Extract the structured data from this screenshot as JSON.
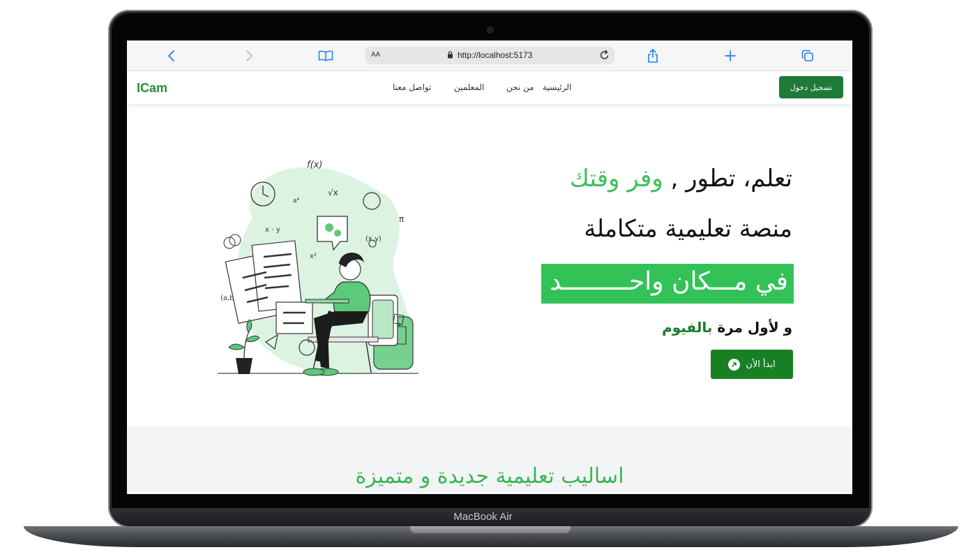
{
  "device": {
    "label": "MacBook Air"
  },
  "browser": {
    "url": "http://localhost:5173",
    "text_size_label": "AA",
    "icons": [
      "back-icon",
      "forward-icon",
      "book-icon",
      "lock-icon",
      "reload-icon",
      "share-icon",
      "plus-icon",
      "tabs-icon"
    ]
  },
  "site": {
    "logo": "ICam",
    "nav": {
      "home": "الرئيسية",
      "about": "من نحن",
      "teachers": "المعلمين",
      "contact": "تواصل معنا"
    },
    "login_button": "تسجيل دخول",
    "colors": {
      "brand_green": "#1e7a37",
      "accent_green": "#33c257",
      "text": "#111111"
    }
  },
  "hero": {
    "line1_black": "تعلم، تطور ,",
    "line1_green": "وفر وقتك",
    "line2": "منصة تعليمية متكاملة",
    "line3": "في مـــكان واحـــــــــد",
    "line4_black": "و لأول مرة",
    "line4_green": "بالفيوم",
    "cta": "ابدأ الأن",
    "cta_icon": "arrow-up-right-icon"
  },
  "section2": {
    "title": "اساليب تعليمية جديدة و متميزة"
  }
}
